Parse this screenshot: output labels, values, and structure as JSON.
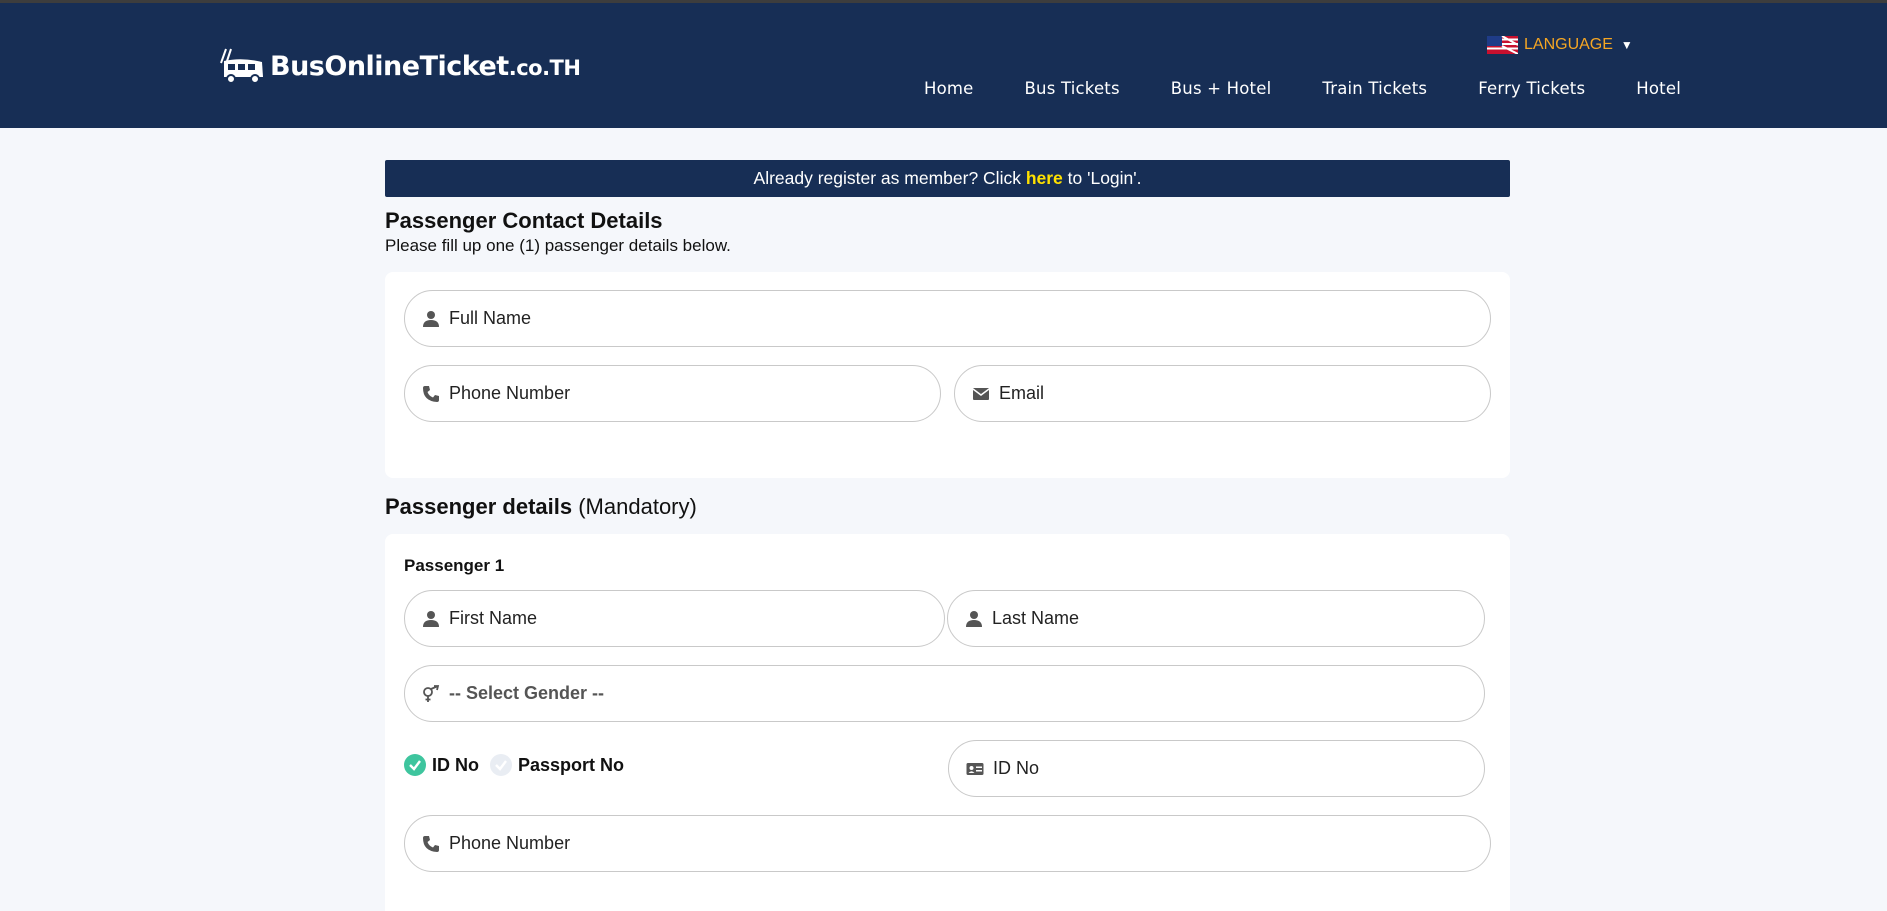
{
  "header": {
    "logo": {
      "name": "BusOnlineTicket",
      "tld": ".co.TH"
    },
    "language_label": "LANGUAGE",
    "nav": [
      "Home",
      "Bus Tickets",
      "Bus + Hotel",
      "Train Tickets",
      "Ferry Tickets",
      "Hotel"
    ]
  },
  "login_bar": {
    "before": "Already register as member? Click ",
    "link": "here",
    "after": " to 'Login'."
  },
  "contact": {
    "title": "Passenger Contact Details",
    "subtitle": "Please fill up one (1) passenger details below.",
    "full_name": "Full Name",
    "phone": "Phone Number",
    "email": "Email"
  },
  "passengers": {
    "title": "Passenger details",
    "title_note": "(Mandatory)",
    "p1": {
      "label": "Passenger 1",
      "first_name": "First Name",
      "last_name": "Last Name",
      "gender": "-- Select Gender --",
      "id_option": "ID No",
      "passport_option": "Passport No",
      "id_field": "ID No",
      "phone": "Phone Number"
    }
  },
  "colors": {
    "header_bg": "#172e55",
    "accent": "#f5a623",
    "link": "#ffe100",
    "check": "#3ec59e"
  }
}
